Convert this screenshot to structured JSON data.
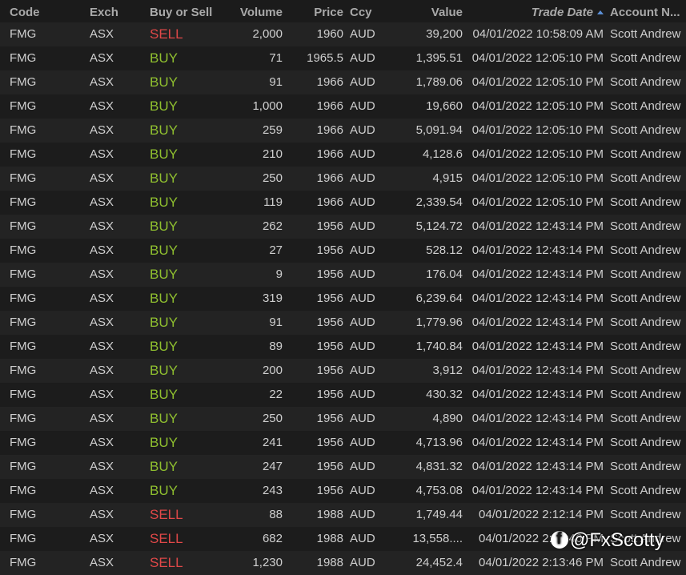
{
  "columns": {
    "code": "Code",
    "exch": "Exch",
    "side": "Buy or Sell",
    "volume": "Volume",
    "price": "Price",
    "ccy": "Ccy",
    "value": "Value",
    "trade_date": "Trade Date",
    "account": "Account N..."
  },
  "sort": {
    "column": "trade_date",
    "direction": "ascending",
    "icon": "sort-ascending-icon"
  },
  "colors": {
    "buy": "#8fbf2f",
    "sell": "#e04848",
    "sort_indicator": "#5b8fd6"
  },
  "rows": [
    {
      "code": "FMG",
      "exch": "ASX",
      "side": "SELL",
      "volume": "2,000",
      "price": "1960",
      "ccy": "AUD",
      "value": "39,200",
      "trade_date": "04/01/2022 10:58:09 AM",
      "account": "Scott Andrew"
    },
    {
      "code": "FMG",
      "exch": "ASX",
      "side": "BUY",
      "volume": "71",
      "price": "1965.5",
      "ccy": "AUD",
      "value": "1,395.51",
      "trade_date": "04/01/2022 12:05:10 PM",
      "account": "Scott Andrew"
    },
    {
      "code": "FMG",
      "exch": "ASX",
      "side": "BUY",
      "volume": "91",
      "price": "1966",
      "ccy": "AUD",
      "value": "1,789.06",
      "trade_date": "04/01/2022 12:05:10 PM",
      "account": "Scott Andrew"
    },
    {
      "code": "FMG",
      "exch": "ASX",
      "side": "BUY",
      "volume": "1,000",
      "price": "1966",
      "ccy": "AUD",
      "value": "19,660",
      "trade_date": "04/01/2022 12:05:10 PM",
      "account": "Scott Andrew"
    },
    {
      "code": "FMG",
      "exch": "ASX",
      "side": "BUY",
      "volume": "259",
      "price": "1966",
      "ccy": "AUD",
      "value": "5,091.94",
      "trade_date": "04/01/2022 12:05:10 PM",
      "account": "Scott Andrew"
    },
    {
      "code": "FMG",
      "exch": "ASX",
      "side": "BUY",
      "volume": "210",
      "price": "1966",
      "ccy": "AUD",
      "value": "4,128.6",
      "trade_date": "04/01/2022 12:05:10 PM",
      "account": "Scott Andrew"
    },
    {
      "code": "FMG",
      "exch": "ASX",
      "side": "BUY",
      "volume": "250",
      "price": "1966",
      "ccy": "AUD",
      "value": "4,915",
      "trade_date": "04/01/2022 12:05:10 PM",
      "account": "Scott Andrew"
    },
    {
      "code": "FMG",
      "exch": "ASX",
      "side": "BUY",
      "volume": "119",
      "price": "1966",
      "ccy": "AUD",
      "value": "2,339.54",
      "trade_date": "04/01/2022 12:05:10 PM",
      "account": "Scott Andrew"
    },
    {
      "code": "FMG",
      "exch": "ASX",
      "side": "BUY",
      "volume": "262",
      "price": "1956",
      "ccy": "AUD",
      "value": "5,124.72",
      "trade_date": "04/01/2022 12:43:14 PM",
      "account": "Scott Andrew"
    },
    {
      "code": "FMG",
      "exch": "ASX",
      "side": "BUY",
      "volume": "27",
      "price": "1956",
      "ccy": "AUD",
      "value": "528.12",
      "trade_date": "04/01/2022 12:43:14 PM",
      "account": "Scott Andrew"
    },
    {
      "code": "FMG",
      "exch": "ASX",
      "side": "BUY",
      "volume": "9",
      "price": "1956",
      "ccy": "AUD",
      "value": "176.04",
      "trade_date": "04/01/2022 12:43:14 PM",
      "account": "Scott Andrew"
    },
    {
      "code": "FMG",
      "exch": "ASX",
      "side": "BUY",
      "volume": "319",
      "price": "1956",
      "ccy": "AUD",
      "value": "6,239.64",
      "trade_date": "04/01/2022 12:43:14 PM",
      "account": "Scott Andrew"
    },
    {
      "code": "FMG",
      "exch": "ASX",
      "side": "BUY",
      "volume": "91",
      "price": "1956",
      "ccy": "AUD",
      "value": "1,779.96",
      "trade_date": "04/01/2022 12:43:14 PM",
      "account": "Scott Andrew"
    },
    {
      "code": "FMG",
      "exch": "ASX",
      "side": "BUY",
      "volume": "89",
      "price": "1956",
      "ccy": "AUD",
      "value": "1,740.84",
      "trade_date": "04/01/2022 12:43:14 PM",
      "account": "Scott Andrew"
    },
    {
      "code": "FMG",
      "exch": "ASX",
      "side": "BUY",
      "volume": "200",
      "price": "1956",
      "ccy": "AUD",
      "value": "3,912",
      "trade_date": "04/01/2022 12:43:14 PM",
      "account": "Scott Andrew"
    },
    {
      "code": "FMG",
      "exch": "ASX",
      "side": "BUY",
      "volume": "22",
      "price": "1956",
      "ccy": "AUD",
      "value": "430.32",
      "trade_date": "04/01/2022 12:43:14 PM",
      "account": "Scott Andrew"
    },
    {
      "code": "FMG",
      "exch": "ASX",
      "side": "BUY",
      "volume": "250",
      "price": "1956",
      "ccy": "AUD",
      "value": "4,890",
      "trade_date": "04/01/2022 12:43:14 PM",
      "account": "Scott Andrew"
    },
    {
      "code": "FMG",
      "exch": "ASX",
      "side": "BUY",
      "volume": "241",
      "price": "1956",
      "ccy": "AUD",
      "value": "4,713.96",
      "trade_date": "04/01/2022 12:43:14 PM",
      "account": "Scott Andrew"
    },
    {
      "code": "FMG",
      "exch": "ASX",
      "side": "BUY",
      "volume": "247",
      "price": "1956",
      "ccy": "AUD",
      "value": "4,831.32",
      "trade_date": "04/01/2022 12:43:14 PM",
      "account": "Scott Andrew"
    },
    {
      "code": "FMG",
      "exch": "ASX",
      "side": "BUY",
      "volume": "243",
      "price": "1956",
      "ccy": "AUD",
      "value": "4,753.08",
      "trade_date": "04/01/2022 12:43:14 PM",
      "account": "Scott Andrew"
    },
    {
      "code": "FMG",
      "exch": "ASX",
      "side": "SELL",
      "volume": "88",
      "price": "1988",
      "ccy": "AUD",
      "value": "1,749.44",
      "trade_date": "04/01/2022 2:12:14 PM",
      "account": "Scott Andrew"
    },
    {
      "code": "FMG",
      "exch": "ASX",
      "side": "SELL",
      "volume": "682",
      "price": "1988",
      "ccy": "AUD",
      "value": "13,558....",
      "trade_date": "04/01/2022 2:13:46 PM",
      "account": "Scott Andrew"
    },
    {
      "code": "FMG",
      "exch": "ASX",
      "side": "SELL",
      "volume": "1,230",
      "price": "1988",
      "ccy": "AUD",
      "value": "24,452.4",
      "trade_date": "04/01/2022 2:13:46 PM",
      "account": "Scott Andrew"
    }
  ],
  "watermark": {
    "text": "@FxScotty",
    "icon": "facebook-icon"
  }
}
